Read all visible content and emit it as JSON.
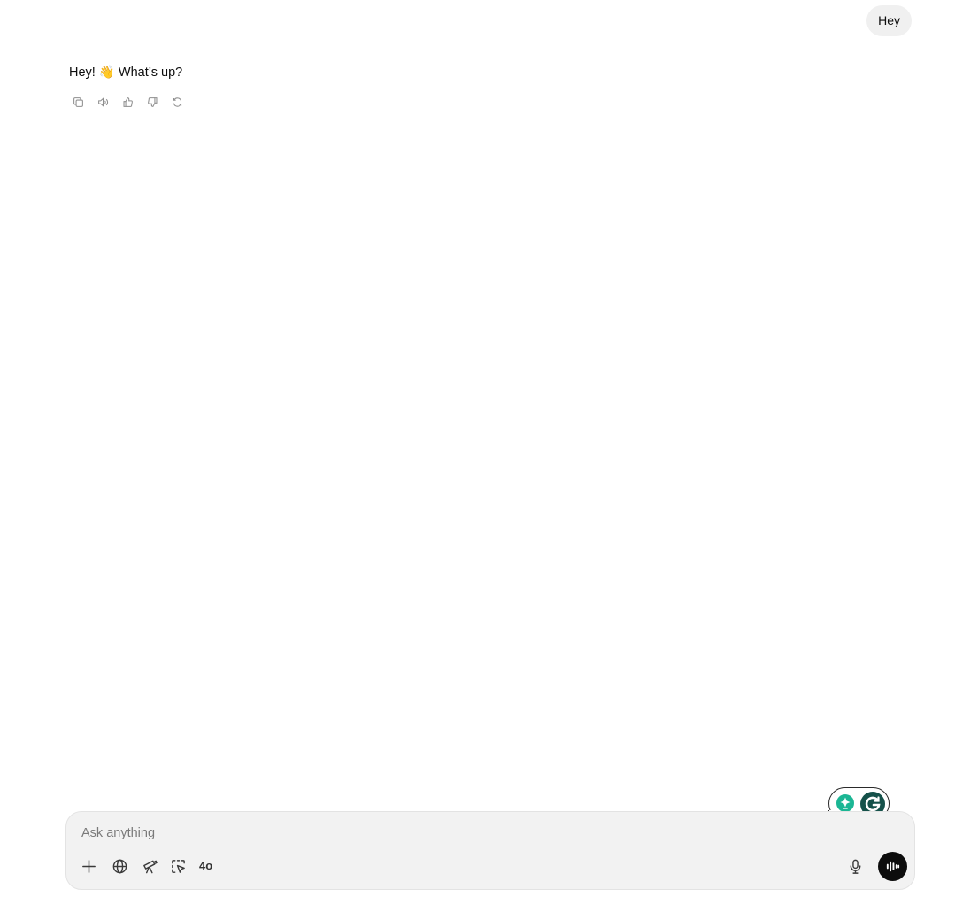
{
  "conversation": {
    "user_message": "Hey",
    "assistant_message": "Hey! 👋 What’s up?"
  },
  "message_actions": [
    {
      "name": "copy-icon"
    },
    {
      "name": "read-aloud-icon"
    },
    {
      "name": "thumbs-up-icon"
    },
    {
      "name": "thumbs-down-icon"
    },
    {
      "name": "regenerate-icon"
    }
  ],
  "composer": {
    "placeholder": "Ask anything",
    "value": "",
    "tools": [
      "plus-icon",
      "globe-icon",
      "telescope-icon",
      "cursor-select-icon"
    ],
    "model_label": "4o",
    "mic_icon": "microphone-icon",
    "voice_icon": "voice-waveform-icon"
  },
  "grammarly": {
    "icons": [
      "grammarly-spark-icon",
      "grammarly-g-icon"
    ],
    "colors": {
      "spark": "#1bb694",
      "g": "#15514a"
    }
  },
  "colors": {
    "user_bubble": "#f0f0f0",
    "composer_bg": "#f2f2f2",
    "voice_button": "#0d0d0d"
  }
}
